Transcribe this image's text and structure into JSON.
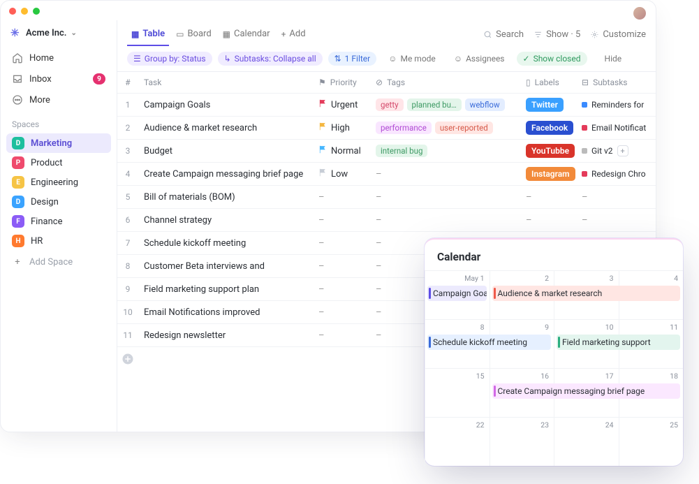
{
  "workspace": {
    "name": "Acme Inc."
  },
  "nav": {
    "home": "Home",
    "inbox": "Inbox",
    "inbox_count": "9",
    "more": "More"
  },
  "spaces_label": "Spaces",
  "spaces": [
    {
      "letter": "D",
      "name": "Marketing",
      "color": "#1dbf9e",
      "active": true
    },
    {
      "letter": "P",
      "name": "Product",
      "color": "#ef4a6d"
    },
    {
      "letter": "E",
      "name": "Engineering",
      "color": "#f6c445"
    },
    {
      "letter": "D",
      "name": "Design",
      "color": "#3aa3ff"
    },
    {
      "letter": "F",
      "name": "Finance",
      "color": "#8b5cf6"
    },
    {
      "letter": "H",
      "name": "HR",
      "color": "#ff7a2f"
    }
  ],
  "add_space": "Add Space",
  "tabs": {
    "table": "Table",
    "board": "Board",
    "calendar": "Calendar",
    "add": "Add"
  },
  "toolbar_right": {
    "search": "Search",
    "show": "Show · 5",
    "customize": "Customize"
  },
  "filters": {
    "group": "Group by: Status",
    "subtasks": "Subtasks: Collapse all",
    "filter": "1 Filter",
    "me": "Me mode",
    "assignees": "Assignees",
    "closed": "Show closed",
    "hide": "Hide"
  },
  "columns": {
    "idx": "#",
    "task": "Task",
    "priority": "Priority",
    "tags": "Tags",
    "labels": "Labels",
    "subtasks": "Subtasks"
  },
  "priority_colors": {
    "Urgent": "#e43b5a",
    "High": "#f4b63f",
    "Normal": "#46b7ff",
    "Low": "#c7cdd6"
  },
  "rows": [
    {
      "n": "1",
      "task": "Campaign Goals",
      "priority": "Urgent",
      "tags": [
        {
          "t": "getty",
          "bg": "#ffe5e8",
          "fg": "#d4496b"
        },
        {
          "t": "planned bu…",
          "bg": "#e3f5ea",
          "fg": "#3e9a64"
        },
        {
          "t": "webflow",
          "bg": "#e3edff",
          "fg": "#3a6bd9"
        }
      ],
      "label": {
        "t": "Twitter",
        "bg": "#3aa0ff"
      },
      "sub": {
        "t": "Reminders for",
        "c": "#3a8bff"
      }
    },
    {
      "n": "2",
      "task": "Audience & market research",
      "priority": "High",
      "tags": [
        {
          "t": "performance",
          "bg": "#f9e6ff",
          "fg": "#b04ad4"
        },
        {
          "t": "user-reported",
          "bg": "#ffe6e3",
          "fg": "#d65a4a"
        }
      ],
      "label": {
        "t": "Facebook",
        "bg": "#2a4fd0"
      },
      "sub": {
        "t": "Email Notificat",
        "c": "#e43b5a"
      }
    },
    {
      "n": "3",
      "task": "Budget",
      "priority": "Normal",
      "tags": [
        {
          "t": "internal bug",
          "bg": "#e3f5ea",
          "fg": "#3e9a64"
        }
      ],
      "label": {
        "t": "YouTubbe",
        "bg": "#d9342a"
      },
      "sub": {
        "t": "Git v2",
        "c": "#bbb",
        "plus": true
      }
    },
    {
      "n": "4",
      "task": "Create Campaign messaging brief page",
      "priority": "Low",
      "tags": [],
      "label": {
        "t": "Instagram",
        "bg": "#f28a3a"
      },
      "sub": {
        "t": "Redesign Chro",
        "c": "#e43b5a"
      }
    },
    {
      "n": "5",
      "task": "Bill of materials (BOM)",
      "priority": "–",
      "tags": [],
      "label": null,
      "sub": null
    },
    {
      "n": "6",
      "task": "Channel strategy",
      "priority": "–",
      "tags": [],
      "label": null,
      "sub": null
    },
    {
      "n": "7",
      "task": "Schedule kickoff meeting",
      "priority": "–",
      "tags": [],
      "label": null,
      "sub": null
    },
    {
      "n": "8",
      "task": "Customer Beta interviews and",
      "priority": "–",
      "tags": [],
      "label": null,
      "sub": null
    },
    {
      "n": "9",
      "task": "Field marketing support plan",
      "priority": "–",
      "tags": [],
      "label": null,
      "sub": null
    },
    {
      "n": "10",
      "task": "Email Notifications improved",
      "priority": "–",
      "tags": [],
      "label": null,
      "sub": null
    },
    {
      "n": "11",
      "task": "Redesign newsletter",
      "priority": "–",
      "tags": [],
      "label": null,
      "sub": null
    }
  ],
  "calendar": {
    "title": "Calendar",
    "dates": [
      "May 1",
      "2",
      "3",
      "4",
      "8",
      "9",
      "10",
      "11",
      "15",
      "16",
      "17",
      "18",
      "22",
      "23",
      "24",
      "25"
    ],
    "events": [
      {
        "span": [
          0,
          0
        ],
        "text": "Campaign Goals",
        "bg": "#eceafd",
        "bar": "#5d4de6"
      },
      {
        "span": [
          1,
          3
        ],
        "text": "Audience & market research",
        "bg": "#ffe6e3",
        "bar": "#ef5a4a"
      },
      {
        "span": [
          4,
          5
        ],
        "text": "Schedule kickoff meeting",
        "bg": "#e6f0ff",
        "bar": "#3a6bd9"
      },
      {
        "span": [
          6,
          7
        ],
        "text": "Field marketing support",
        "bg": "#e3f5ee",
        "bar": "#2aae7f"
      },
      {
        "span": [
          9,
          11
        ],
        "text": "Create Campaign messaging brief page",
        "bg": "#fbe8ff",
        "bar": "#d268e6"
      }
    ]
  }
}
